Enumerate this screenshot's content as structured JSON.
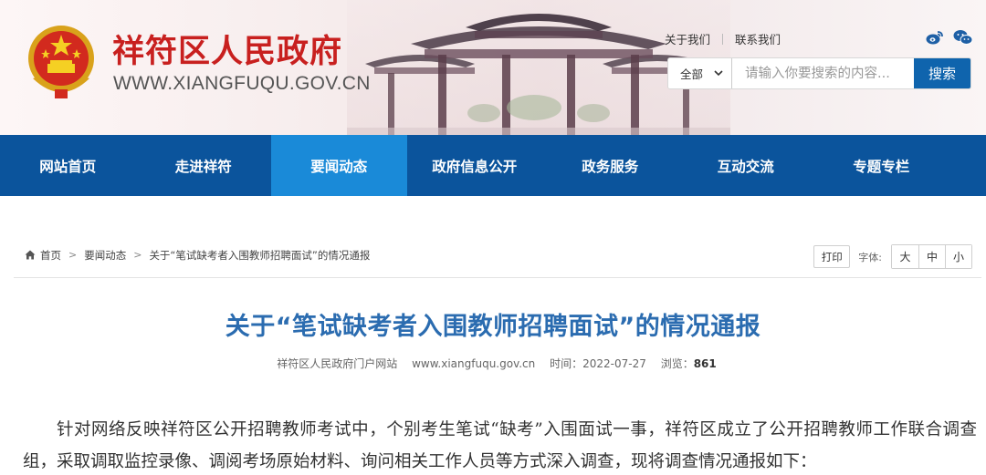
{
  "header": {
    "site_name": "祥符区人民政府",
    "site_domain": "WWW.XIANGFUQU.GOV.CN",
    "top_links": [
      "关于我们",
      "联系我们"
    ],
    "social_icons": [
      "weibo-icon",
      "wechat-icon"
    ],
    "search": {
      "scope_selected": "全部",
      "placeholder": "请输入你要搜索的内容...",
      "button_label": "搜索"
    }
  },
  "nav": {
    "items": [
      "网站首页",
      "走进祥符",
      "要闻动态",
      "政府信息公开",
      "政务服务",
      "互动交流",
      "专题专栏"
    ],
    "active": "要闻动态"
  },
  "breadcrumb": {
    "items": [
      "首页",
      "要闻动态",
      "关于“笔试缺考者入围教师招聘面试”的情况通报"
    ]
  },
  "tools": {
    "print_label": "打印",
    "font_label": "字体:",
    "font_sizes": [
      "大",
      "中",
      "小"
    ]
  },
  "article": {
    "title": "关于“笔试缺考者入围教师招聘面试”的情况通报",
    "source": "祥符区人民政府门户网站",
    "url": "www.xiangfuqu.gov.cn",
    "time_label": "时间：",
    "time": "2022-07-27",
    "views_label": "浏览：",
    "views": "861",
    "paragraph": "针对网络反映祥符区公开招聘教师考试中，个别考生笔试“缺考”入围面试一事，祥符区成立了公开招聘教师工作联合调查组，采取调取监控录像、调阅考场原始材料、询问相关工作人员等方式深入调查，现将调查情况通报如下："
  },
  "colors": {
    "brand_red": "#c8201f",
    "nav_blue": "#0b549c",
    "nav_active": "#1a8ad8",
    "title_blue": "#2b6cb0",
    "search_button": "#0f64ad"
  }
}
